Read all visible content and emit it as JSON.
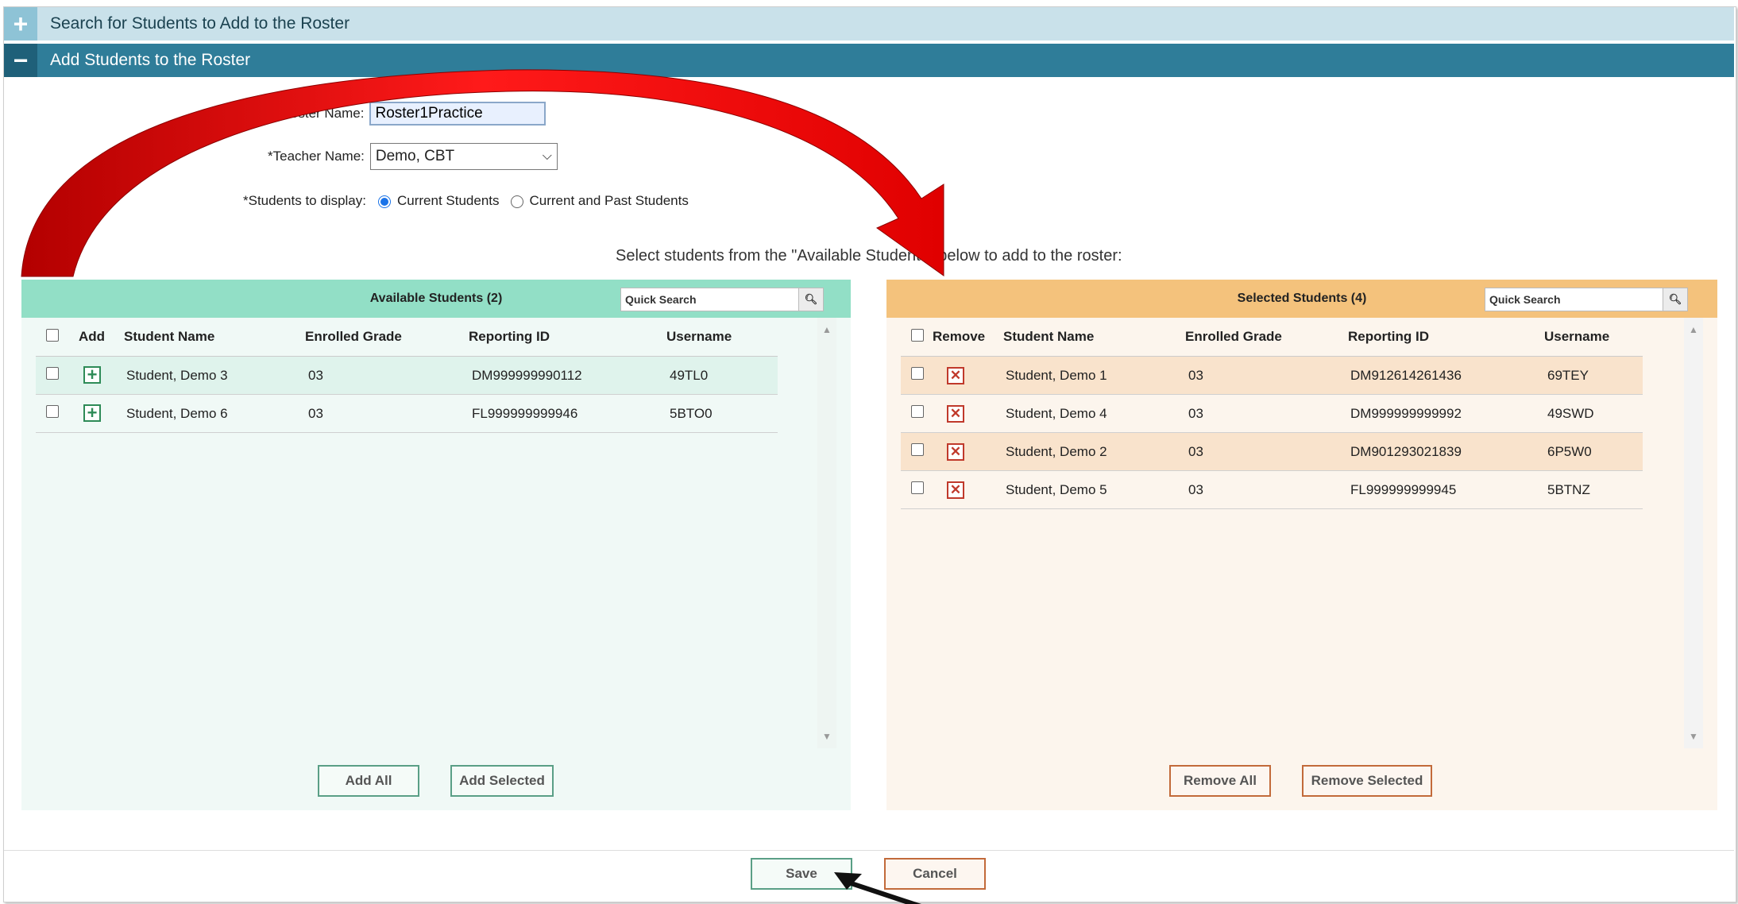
{
  "search_section": {
    "toggle": "+",
    "title": "Search for Students to Add to the Roster"
  },
  "add_section": {
    "toggle": "−",
    "title": "Add Students to the Roster"
  },
  "form": {
    "roster_name_label": "*Roster Name:",
    "roster_name_value": "Roster1Practice",
    "teacher_name_label": "*Teacher Name:",
    "teacher_name_value": "Demo, CBT",
    "display_label": "*Students to display:",
    "display_options": [
      "Current Students",
      "Current and Past Students"
    ],
    "display_selected": "Current Students"
  },
  "instruction": "Select students from the \"Available Students\" below to add to the roster:",
  "available": {
    "title": "Available Students (2)",
    "quick_search": "Quick Search",
    "columns": {
      "add": "Add",
      "name": "Student Name",
      "grade": "Enrolled Grade",
      "rid": "Reporting ID",
      "user": "Username"
    },
    "rows": [
      {
        "name": "Student, Demo 3",
        "grade": "03",
        "rid": "DM999999990112",
        "user": "49TL0"
      },
      {
        "name": "Student, Demo 6",
        "grade": "03",
        "rid": "FL999999999946",
        "user": "5BTO0"
      }
    ],
    "buttons": {
      "add_all": "Add All",
      "add_selected": "Add Selected"
    }
  },
  "selected": {
    "title": "Selected Students (4)",
    "quick_search": "Quick Search",
    "columns": {
      "remove": "Remove",
      "name": "Student Name",
      "grade": "Enrolled Grade",
      "rid": "Reporting ID",
      "user": "Username"
    },
    "rows": [
      {
        "name": "Student, Demo 1",
        "grade": "03",
        "rid": "DM912614261436",
        "user": "69TEY"
      },
      {
        "name": "Student, Demo 4",
        "grade": "03",
        "rid": "DM999999999992",
        "user": "49SWD"
      },
      {
        "name": "Student, Demo 2",
        "grade": "03",
        "rid": "DM901293021839",
        "user": "6P5W0"
      },
      {
        "name": "Student, Demo 5",
        "grade": "03",
        "rid": "FL999999999945",
        "user": "5BTNZ"
      }
    ],
    "buttons": {
      "remove_all": "Remove All",
      "remove_selected": "Remove Selected"
    }
  },
  "footer": {
    "save": "Save",
    "cancel": "Cancel"
  },
  "icons": {
    "add_row": "plus-icon",
    "remove_row": "x-icon",
    "search": "magnifier-icon",
    "arrow": "red-curved-arrow",
    "pointer": "black-arrow-pointer"
  },
  "colors": {
    "header_dark": "#2f7d99",
    "available_header": "#92dfc6",
    "selected_header": "#f4c27c",
    "arrow": "#e00000"
  }
}
